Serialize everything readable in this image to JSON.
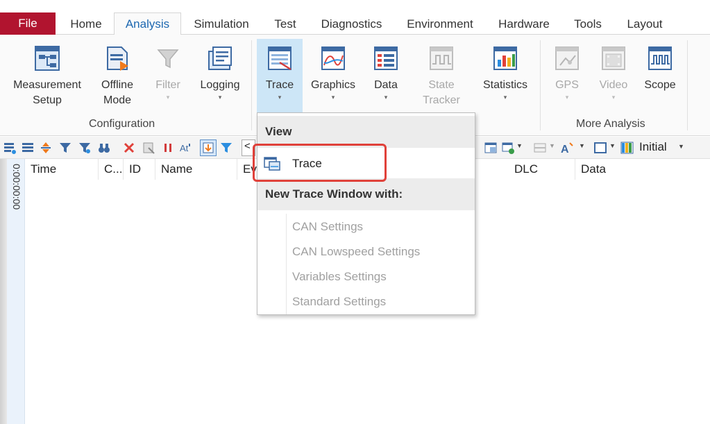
{
  "tabs": {
    "file": "File",
    "items": [
      "Home",
      "Analysis",
      "Simulation",
      "Test",
      "Diagnostics",
      "Environment",
      "Hardware",
      "Tools",
      "Layout"
    ],
    "active": "Analysis"
  },
  "ribbon": {
    "configuration": {
      "group_label": "Configuration",
      "measurement_setup": [
        "Measurement",
        "Setup"
      ],
      "offline_mode": [
        "Offline",
        "Mode"
      ],
      "filter": "Filter",
      "logging": "Logging"
    },
    "analysis": {
      "trace": "Trace",
      "graphics": "Graphics",
      "data": "Data",
      "state_tracker": [
        "State",
        "Tracker"
      ],
      "statistics": "Statistics"
    },
    "more_analysis": {
      "group_label": "More Analysis",
      "gps": "GPS",
      "video": "Video",
      "scope": "Scope"
    }
  },
  "toolbar": {
    "search_prefix": "<",
    "initial_label": "Initial"
  },
  "trace_window": {
    "time_marker": "0:00:00:00",
    "columns": [
      "Time",
      "C...",
      "ID",
      "Name",
      "Ev",
      "DLC",
      "Data"
    ]
  },
  "dropdown": {
    "view_header": "View",
    "trace_item": "Trace",
    "new_header": "New Trace Window with:",
    "templates": [
      "CAN Settings",
      "CAN Lowspeed Settings",
      "Variables Settings",
      "Standard Settings"
    ]
  },
  "colors": {
    "file_tab": "#b1142f",
    "active_tab_text": "#1c67b0",
    "highlight_box": "#e0413a",
    "selected_button": "#cde6f7"
  }
}
